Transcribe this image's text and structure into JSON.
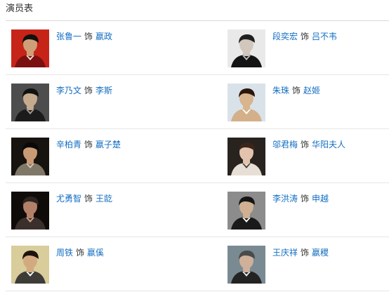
{
  "header": {
    "title": "演员表"
  },
  "cast": [
    {
      "actor": "张鲁一",
      "connector": "饰",
      "role": "嬴政",
      "photo": {
        "background": "#c72418",
        "skin": "#cf9f78",
        "hair": "#14100e",
        "clothing": "#7b1011",
        "accent": "#f1e3cf"
      }
    },
    {
      "actor": "段奕宏",
      "connector": "饰",
      "role": "吕不韦",
      "photo": {
        "background": "#e9e9e9",
        "skin": "#d2c7bd",
        "hair": "#202020",
        "clothing": "#141414",
        "accent": "#bdbdbd"
      }
    },
    {
      "actor": "李乃文",
      "connector": "饰",
      "role": "李斯",
      "photo": {
        "background": "#4d4d4d",
        "skin": "#c5aa8d",
        "hair": "#111111",
        "clothing": "#1b1b1b",
        "accent": "#9f9f9f"
      }
    },
    {
      "actor": "朱珠",
      "connector": "饰",
      "role": "赵姬",
      "photo": {
        "background": "#d9e2e9",
        "skin": "#d8b48f",
        "hair": "#2b160e",
        "clothing": "#d3b08a",
        "accent": "#ffffff"
      }
    },
    {
      "actor": "辛柏青",
      "connector": "饰",
      "role": "嬴子楚",
      "photo": {
        "background": "#17130f",
        "skin": "#c99b75",
        "hair": "#090909",
        "clothing": "#7f7768",
        "accent": "#d2c7b0"
      }
    },
    {
      "actor": "邬君梅",
      "connector": "饰",
      "role": "华阳夫人",
      "photo": {
        "background": "#28231f",
        "skin": "#e3c3ad",
        "hair": "#3b251a",
        "clothing": "#e7dfd6",
        "accent": "#4f4037"
      }
    },
    {
      "actor": "尤勇智",
      "connector": "饰",
      "role": "王龁",
      "photo": {
        "background": "#0f0b09",
        "skin": "#b28068",
        "hair": "#2b2522",
        "clothing": "#3a302b",
        "accent": "#d4a58a"
      }
    },
    {
      "actor": "李洪涛",
      "connector": "饰",
      "role": "申越",
      "photo": {
        "background": "#8c8c8c",
        "skin": "#d0b092",
        "hair": "#151515",
        "clothing": "#1a1a1a",
        "accent": "#ffffff"
      }
    },
    {
      "actor": "周铁",
      "connector": "饰",
      "role": "嬴傒",
      "photo": {
        "background": "#d8cd9b",
        "skin": "#d3aa80",
        "hair": "#1d120d",
        "clothing": "#3e3c37",
        "accent": "#ffffff"
      }
    },
    {
      "actor": "王庆祥",
      "connector": "饰",
      "role": "嬴稷",
      "photo": {
        "background": "#7a8a92",
        "skin": "#ceb09b",
        "hair": "#4a4a4a",
        "clothing": "#232323",
        "accent": "#ececec"
      }
    }
  ]
}
